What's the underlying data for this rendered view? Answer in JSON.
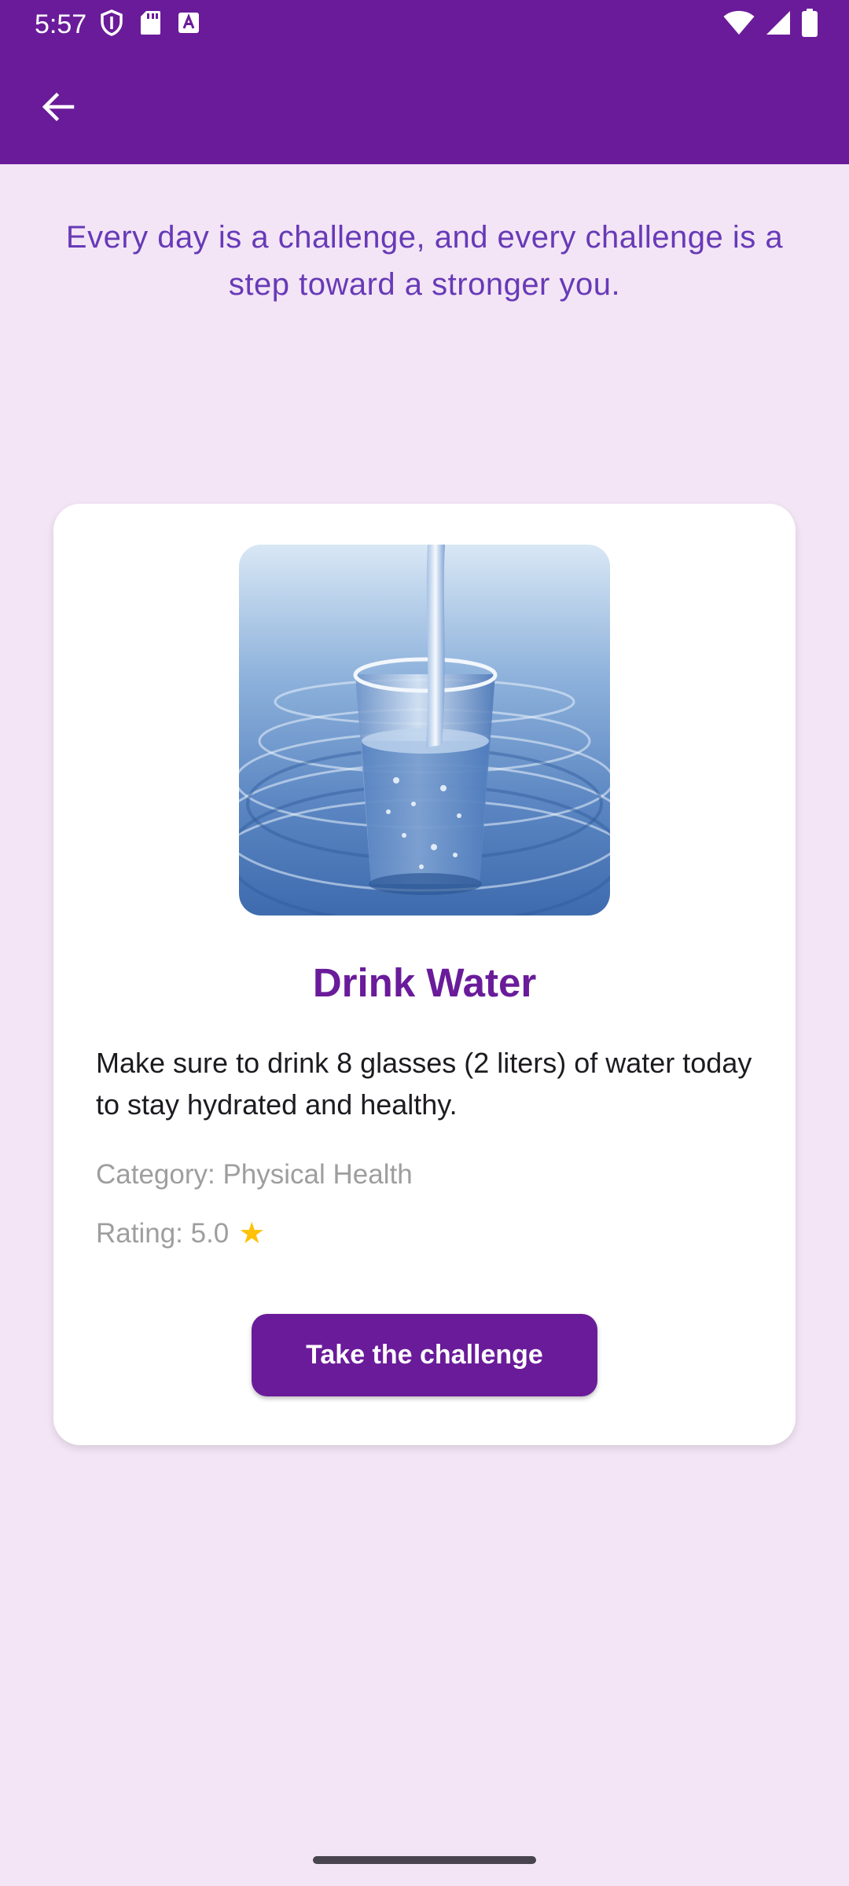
{
  "status_bar": {
    "time": "5:57",
    "left_icons": [
      "shield-icon",
      "sd-card-icon",
      "text-a-icon"
    ],
    "right_icons": [
      "wifi-icon",
      "signal-icon",
      "battery-icon"
    ]
  },
  "app_bar": {
    "back_icon": "arrow-back-icon",
    "color": "#6A1B9A"
  },
  "quote": "Every day is a challenge, and every challenge is a step toward a stronger you.",
  "challenge": {
    "image": "glass-of-water",
    "title": "Drink Water",
    "description": "Make sure to drink 8 glasses (2 liters) of water today to stay hydrated and healthy.",
    "category": "Category: Physical Health",
    "rating": "Rating: 5.0",
    "rating_icon": "star-icon",
    "button_label": "Take the challenge"
  },
  "colors": {
    "primary": "#6A1B9A",
    "background": "#F3E5F5",
    "quote_text": "#673AB7",
    "muted_text": "#9E9E9E",
    "star": "#FFC107"
  }
}
